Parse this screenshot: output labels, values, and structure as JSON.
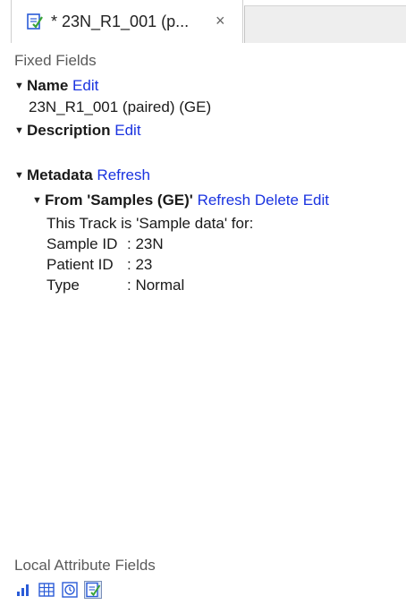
{
  "tab": {
    "title": "* 23N_R1_001 (p...",
    "close_glyph": "×",
    "icon": "document-edit-icon"
  },
  "fixed_fields": {
    "header": "Fixed Fields",
    "name": {
      "label": "Name",
      "edit": "Edit",
      "value": "23N_R1_001 (paired) (GE)"
    },
    "description": {
      "label": "Description",
      "edit": "Edit"
    },
    "metadata": {
      "label": "Metadata",
      "refresh": "Refresh",
      "source": {
        "label": "From 'Samples (GE)'",
        "refresh": "Refresh",
        "delete": "Delete",
        "edit": "Edit",
        "intro": "This Track is 'Sample data' for:",
        "fields": [
          {
            "key": "Sample ID",
            "value": ": 23N"
          },
          {
            "key": "Patient ID",
            "value": ": 23"
          },
          {
            "key": "Type",
            "value": ": Normal"
          }
        ]
      }
    }
  },
  "local_attribute_fields": {
    "header": "Local Attribute Fields",
    "icons": [
      "bar-chart-icon",
      "table-icon",
      "history-icon",
      "document-edit-icon"
    ],
    "selected_icon": "document-edit-icon"
  },
  "colors": {
    "link": "#1a33e0",
    "icon_blue": "#2a5bd7",
    "icon_green": "#3aa33a"
  }
}
